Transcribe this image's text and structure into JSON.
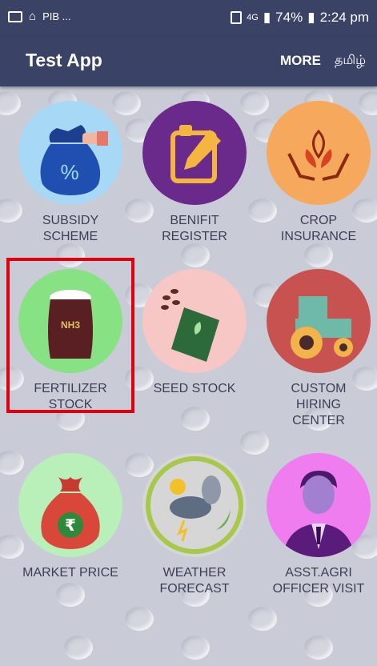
{
  "status_bar": {
    "left_text": "PIB ...",
    "network": "4G",
    "battery": "74%",
    "time": "2:24 pm"
  },
  "app_bar": {
    "title": "Test App",
    "more": "MORE",
    "language": "தமிழ்"
  },
  "tiles": [
    {
      "label_line1": "SUBSIDY",
      "label_line2": "SCHEME",
      "icon": "money-bag-percent-icon",
      "color": "#a7d8f5"
    },
    {
      "label_line1": "BENIFIT",
      "label_line2": "REGISTER",
      "icon": "document-pen-icon",
      "color": "#6a2a8c"
    },
    {
      "label_line1": "CROP",
      "label_line2": "INSURANCE",
      "icon": "hands-leaf-icon",
      "color": "#f6a85d"
    },
    {
      "label_line1": "FERTILIZER",
      "label_line2": "STOCK",
      "icon": "fertilizer-sack-icon",
      "color": "#86e283",
      "sack_text": "NH3"
    },
    {
      "label_line1": "SEED STOCK",
      "label_line2": "",
      "icon": "seed-packet-icon",
      "color": "#f7c7c5"
    },
    {
      "label_line1": "CUSTOM",
      "label_line2": "HIRING",
      "label_line3": "CENTER",
      "icon": "tractor-icon",
      "color": "#c85250"
    },
    {
      "label_line1": "MARKET PRICE",
      "label_line2": "",
      "icon": "rupee-bag-icon",
      "color": "#b9f0b9"
    },
    {
      "label_line1": "WEATHER",
      "label_line2": "FORECAST",
      "icon": "weather-storm-icon",
      "color": "#d6d6d6"
    },
    {
      "label_line1": "ASST.AGRI",
      "label_line2": "OFFICER VISIT",
      "icon": "officer-avatar-icon",
      "color": "#f07df0"
    }
  ]
}
